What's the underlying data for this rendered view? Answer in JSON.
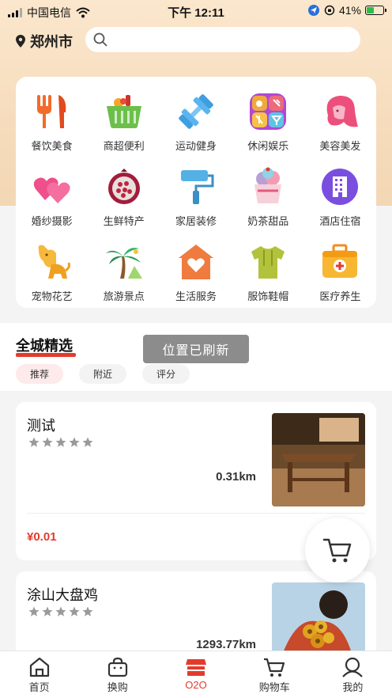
{
  "status_bar": {
    "carrier": "中国电信",
    "time": "下午 12:11",
    "battery": "41%",
    "battery_level": 0.41
  },
  "header": {
    "city": "郑州市",
    "search_placeholder": ""
  },
  "categories": [
    {
      "label": "餐饮美食",
      "icon": "fork-knife-icon"
    },
    {
      "label": "商超便利",
      "icon": "basket-icon"
    },
    {
      "label": "运动健身",
      "icon": "dumbbell-icon"
    },
    {
      "label": "休闲娱乐",
      "icon": "entertainment-icon"
    },
    {
      "label": "美容美发",
      "icon": "hair-icon"
    },
    {
      "label": "婚纱摄影",
      "icon": "hearts-icon"
    },
    {
      "label": "生鲜特产",
      "icon": "pomegranate-icon"
    },
    {
      "label": "家居装修",
      "icon": "paint-roller-icon"
    },
    {
      "label": "奶茶甜品",
      "icon": "ice-cream-icon"
    },
    {
      "label": "酒店住宿",
      "icon": "hotel-icon"
    },
    {
      "label": "宠物花艺",
      "icon": "dog-icon"
    },
    {
      "label": "旅游景点",
      "icon": "palm-tree-icon"
    },
    {
      "label": "生活服务",
      "icon": "house-heart-icon"
    },
    {
      "label": "服饰鞋帽",
      "icon": "shirt-icon"
    },
    {
      "label": "医疗养生",
      "icon": "medical-kit-icon"
    }
  ],
  "section": {
    "title": "全城精选",
    "toast": "位置已刷新",
    "filters": [
      "推荐",
      "附近",
      "评分"
    ]
  },
  "stores": [
    {
      "name": "测试",
      "rating_stars": 5,
      "distance": "0.31km",
      "price": "¥0.01"
    },
    {
      "name": "涂山大盘鸡",
      "rating_stars": 5,
      "distance": "1293.77km"
    }
  ],
  "tabbar": [
    {
      "label": "首页",
      "icon": "home-icon"
    },
    {
      "label": "换购",
      "icon": "shopping-bag-icon"
    },
    {
      "label": "O2O",
      "icon": "store-icon",
      "active": true
    },
    {
      "label": "购物车",
      "icon": "cart-icon"
    },
    {
      "label": "我的",
      "icon": "user-icon"
    }
  ],
  "colors": {
    "accent": "#e23b2c",
    "header_bg": "#f6dcbc"
  }
}
